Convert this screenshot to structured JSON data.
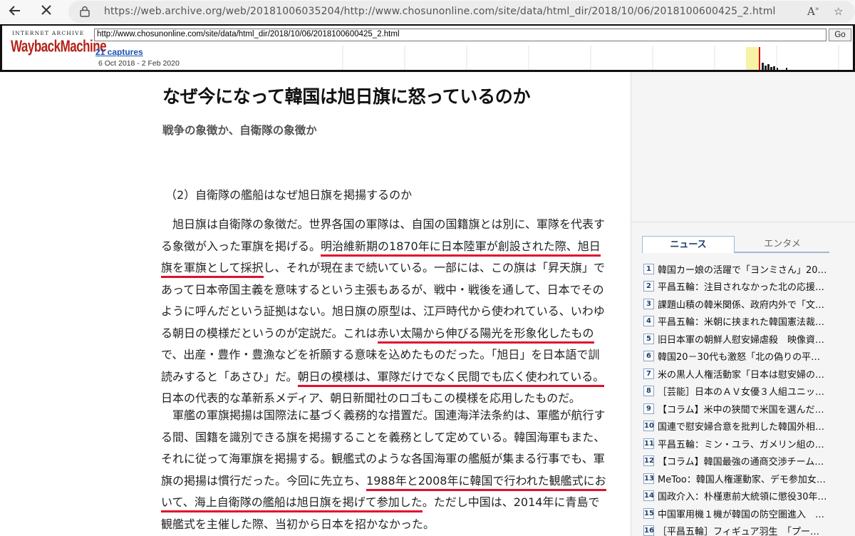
{
  "browser": {
    "url": "https://web.archive.org/web/20181006035204/http://www.chosunonline.com/site/data/html_dir/2018/10/06/2018100600425_2.html",
    "read_aloud_icon": "read-aloud-icon",
    "favorites_icon": "add-favorite-icon"
  },
  "wayback": {
    "logo_top": "INTERNET ARCHIVE",
    "logo": "WaybackMachine",
    "url_value": "http://www.chosunonline.com/site/data/html_dir/2018/10/06/2018100600425_2.html",
    "go_label": "Go",
    "captures": "21 captures",
    "range": "6 Oct 2018 - 2 Feb 2020"
  },
  "article": {
    "title": "なぜ今になって韓国は旭日旗に怒っているのか",
    "subtitle": "戦争の象徴か、自衛隊の象徴か",
    "section": "（2）自衛隊の艦船はなぜ旭日旗を掲揚するのか",
    "paragraph1": [
      [
        {
          "t": "　旭日旗は自衛隊の象徴だ。世界各国の軍隊は、自国の国籍旗とは別に、軍隊を代表す"
        }
      ],
      [
        {
          "t": "る象徴が入った軍旗を掲げる。"
        },
        {
          "t": "明治維新期の1870年に日本陸軍が創設された際、旭日",
          "hl": true
        }
      ],
      [
        {
          "t": "旗を軍旗として採択",
          "hl": true
        },
        {
          "t": "し、それが現在まで続いている。一部には、この旗は「昇天旗」で"
        }
      ],
      [
        {
          "t": "あって日本帝国主義を意味するという主張もあるが、戦中・戦後を通して、日本でその"
        }
      ],
      [
        {
          "t": "ように呼んだという証拠はない。旭日旗の原型は、江戸時代から使われている、いわゆ"
        }
      ],
      [
        {
          "t": "る朝日の模様だというのが定説だ。これは"
        },
        {
          "t": "赤い太陽から伸びる陽光を形象化したもの",
          "hl": true
        }
      ],
      [
        {
          "t": "で、出産・豊作・豊漁などを祈願する意味を込めたものだった。「旭日」を日本語で訓"
        }
      ],
      [
        {
          "t": "読みすると「あさひ」だ。"
        },
        {
          "t": "朝日の模様は、軍隊だけでなく民間でも広く使われている。",
          "hl": true
        }
      ],
      [
        {
          "t": "日本の代表的な革新系メディア、朝日新聞社のロゴもこの模様を応用したものだ。"
        }
      ]
    ],
    "paragraph2": [
      [
        {
          "t": "　軍艦の軍旗掲揚は国際法に基づく義務的な措置だ。国連海洋法条約は、軍艦が航行す"
        }
      ],
      [
        {
          "t": "る間、国籍を識別できる旗を掲揚することを義務として定めている。韓国海軍もまた、"
        }
      ],
      [
        {
          "t": "それに従って海軍旗を掲揚する。観艦式のような各国海軍の艦艇が集まる行事でも、軍"
        }
      ],
      [
        {
          "t": "旗の掲揚は慣行だった。今回に先立ち、"
        },
        {
          "t": "1988年と2008年に韓国で行われた観艦式にお",
          "hl": true
        }
      ],
      [
        {
          "t": "いて、海上自衛隊の艦船は旭日旗を掲げて参加した",
          "hl": true
        },
        {
          "t": "。ただし中国は、2014年に青島で"
        }
      ],
      [
        {
          "t": "観艦式を主催した際、当初から日本を招かなかった。"
        }
      ]
    ]
  },
  "sidebar": {
    "tab_news": "ニュース",
    "tab_entame": "エンタメ",
    "news": [
      {
        "n": "1",
        "text": "韓国カー娘の活躍で「ヨンミさん」20…"
      },
      {
        "n": "2",
        "text": "平昌五輪：注目されなかった北の応援…"
      },
      {
        "n": "3",
        "text": "課題山積の韓米関係、政府内外で「文…"
      },
      {
        "n": "4",
        "text": "平昌五輪：米朝に挟まれた韓国憲法裁…"
      },
      {
        "n": "5",
        "text": "旧日本軍の朝鮮人慰安婦虐殺　映像資…"
      },
      {
        "n": "6",
        "text": "韓国20－30代も激怒「北の偽りの平…"
      },
      {
        "n": "7",
        "text": "米の黒人人権活動家「日本は慰安婦の…"
      },
      {
        "n": "8",
        "text": "［芸能］日本のＡＶ女優３人組ユニッ…"
      },
      {
        "n": "9",
        "text": "【コラム】米中の狭間で米国を選んだ…"
      },
      {
        "n": "10",
        "text": "国連で慰安婦合意を批判した韓国外相…"
      },
      {
        "n": "11",
        "text": "平昌五輪：ミン・ユラ、ガメリン組の…"
      },
      {
        "n": "12",
        "text": "【コラム】韓国最強の通商交渉チーム…"
      },
      {
        "n": "13",
        "text": "MeToo：韓国人権運動家、デモ参加女…"
      },
      {
        "n": "14",
        "text": "国政介入：朴槿恵前大統領に懲役30年…"
      },
      {
        "n": "15",
        "text": "中国軍用機１機が韓国の防空圏進入　…"
      },
      {
        "n": "16",
        "text": "［平昌五輪］フィギュア羽生　「プー…"
      }
    ]
  },
  "colors": {
    "highlight_underline": "#e0102b",
    "wayback_red": "#b3231a",
    "link_blue": "#1a53b0"
  }
}
